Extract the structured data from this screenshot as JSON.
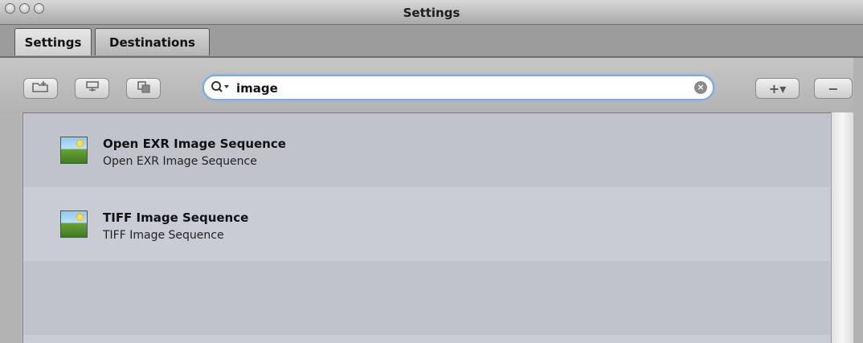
{
  "window": {
    "title": "Settings"
  },
  "tabs": [
    {
      "label": "Settings",
      "active": true
    },
    {
      "label": "Destinations",
      "active": false
    }
  ],
  "toolbar": {
    "icons": [
      "new-folder-icon",
      "new-group-icon",
      "duplicate-icon"
    ],
    "add_label": "+▾",
    "remove_label": "−"
  },
  "search": {
    "value": "image",
    "icon": "search-icon",
    "clear_icon": "clear-icon"
  },
  "list": {
    "items": [
      {
        "title": "Open EXR Image Sequence",
        "subtitle": "Open EXR Image Sequence",
        "icon": "image-icon"
      },
      {
        "title": "TIFF Image Sequence",
        "subtitle": "TIFF Image Sequence",
        "icon": "image-icon"
      }
    ]
  },
  "colors": {
    "search_focus": "#7fa9dd",
    "list_row_alt": "#c0c3cb",
    "list_row": "#c9ccd4"
  }
}
